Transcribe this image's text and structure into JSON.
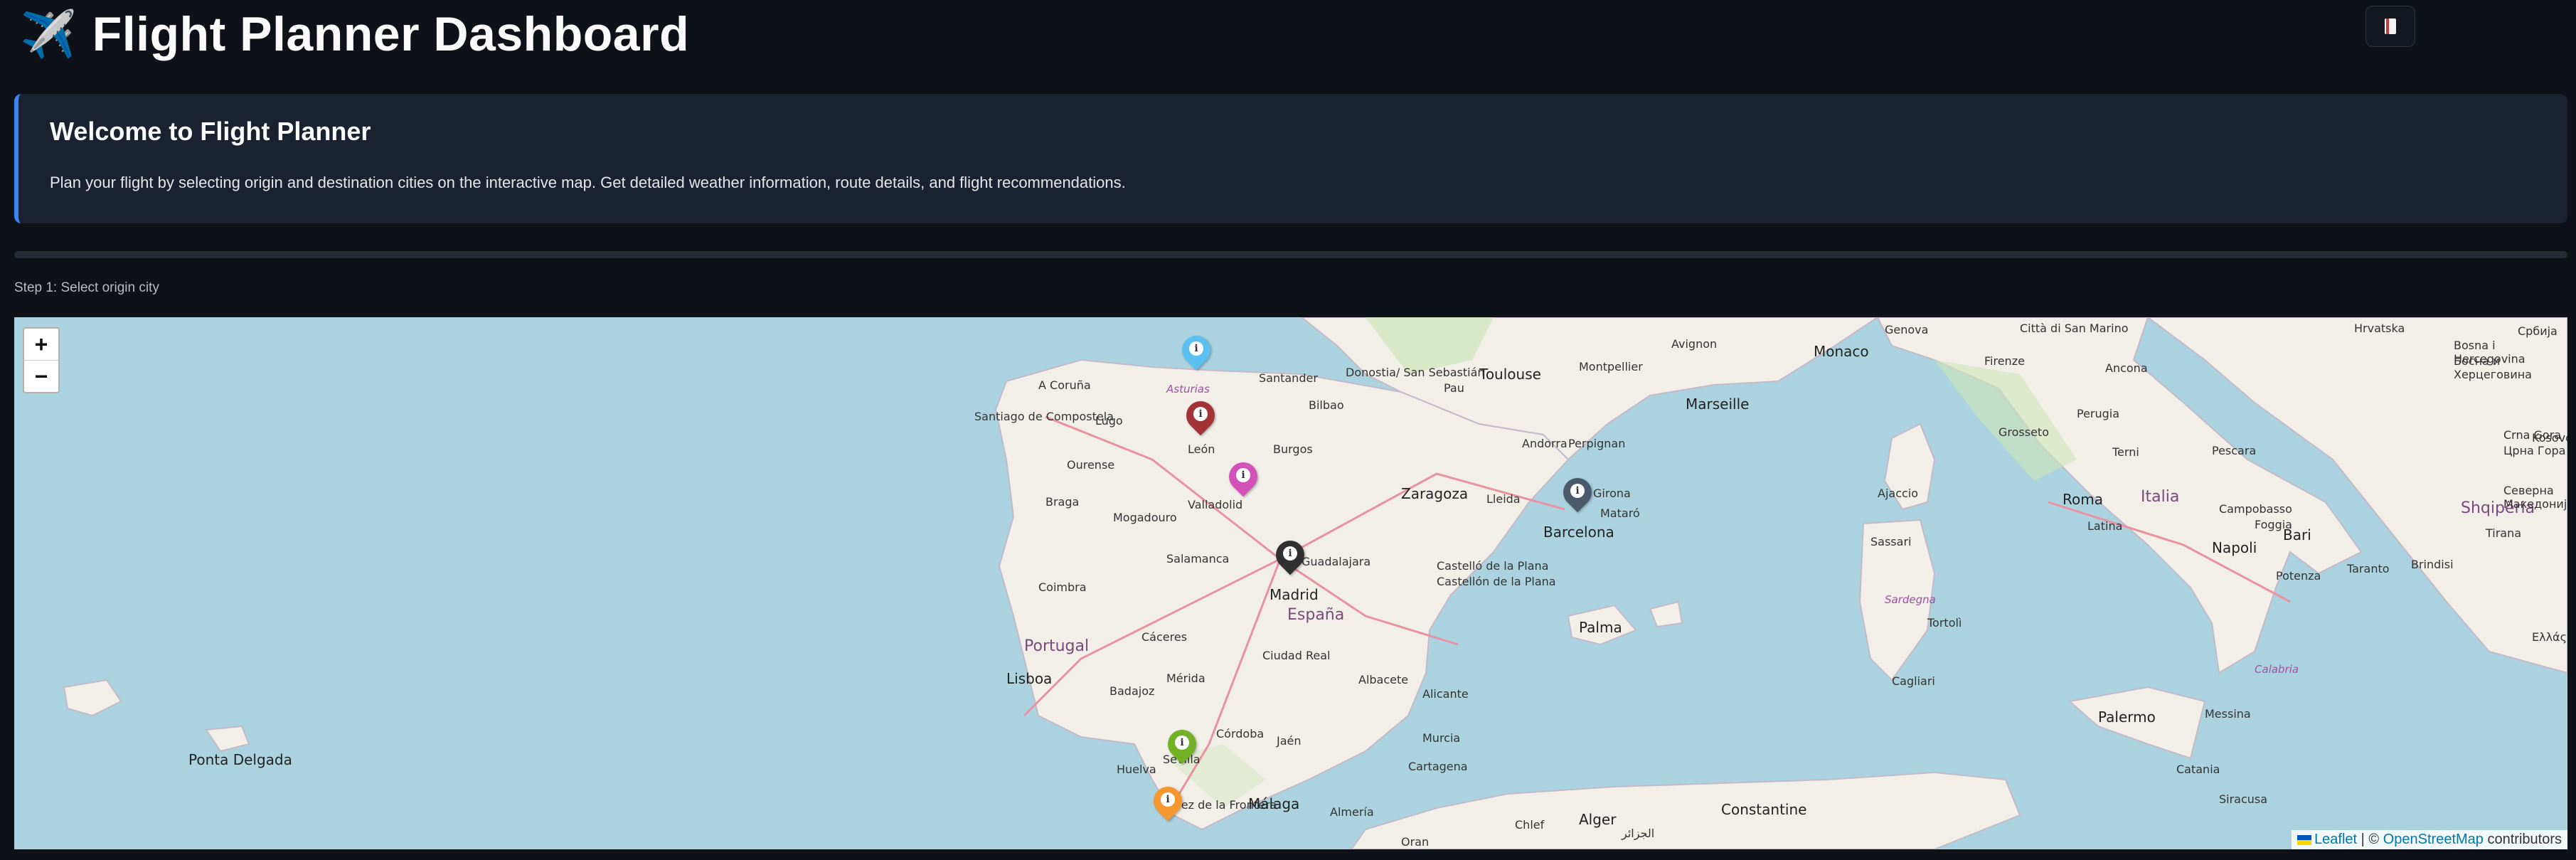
{
  "header": {
    "title": "Flight Planner Dashboard",
    "plane_icon": "✈️",
    "deploy_icon": "book-icon"
  },
  "welcome": {
    "title": "Welcome to Flight Planner",
    "text": "Plan your flight by selecting origin and destination cities on the interactive map. Get detailed weather information, route details, and flight recommendations."
  },
  "step_label": "Step 1: Select origin city",
  "map": {
    "zoom_in": "+",
    "zoom_out": "−",
    "attribution": {
      "leaflet": "Leaflet",
      "separator": " | © ",
      "osm": "OpenStreetMap",
      "suffix": " contributors"
    },
    "markers": [
      {
        "color": "#5bc0f0"
      },
      {
        "color": "#a23336"
      },
      {
        "color": "#d252b9"
      },
      {
        "color": "#4a5a6a"
      },
      {
        "color": "#303030"
      },
      {
        "color": "#72b026"
      },
      {
        "color": "#f69730"
      }
    ],
    "labels": [
      "Genova",
      "Monaco",
      "Città di San Marino",
      "Hrvatska",
      "Bosna i Hercegovina",
      "Босна и Херцеговина",
      "Србија",
      "Montpellier",
      "Avignon",
      "Toulouse",
      "Firenze",
      "Ancona",
      "Grosseto",
      "Perugia",
      "Crna Gora",
      "Црна Гора",
      "Marseille",
      "Pau",
      "Andorra",
      "Perpignan",
      "Santander",
      "Donostia/ San Sebastián",
      "Bilbao",
      "Asturias",
      "A Coruña",
      "Santiago de Compostela",
      "Lugo",
      "León",
      "Burgos",
      "Ourense",
      "Valladolid",
      "Zaragoza",
      "Lleida",
      "Girona",
      "Mataró",
      "Barcelona",
      "Braga",
      "Mogadouro",
      "Salamanca",
      "Guadalajara",
      "Madrid",
      "España",
      "Castelló de la Plana",
      "Castellón de la Plana",
      "Coimbra",
      "Portugal",
      "Cáceres",
      "Lisboa",
      "Mérida",
      "Ciudad Real",
      "Albacete",
      "Alicante",
      "Badajoz",
      "Córdoba",
      "Jaén",
      "Murcia",
      "Cartagena",
      "Huelva",
      "Sevilla",
      "Jerez de la Frontera",
      "Málaga",
      "Almería",
      "Palma",
      "Roma",
      "Italia",
      "Napoli",
      "Potenza",
      "Foggia",
      "Bari",
      "Taranto",
      "Brindisi",
      "Tirana",
      "Shqipëria",
      "Sardegna",
      "Cagliari",
      "Sassari",
      "Tortolì",
      "Ajaccio",
      "Palermo",
      "Messina",
      "Catania",
      "Siracusa",
      "Calabria",
      "Ελλάς",
      "Alger",
      "الجزائر",
      "Constantine",
      "Chlef",
      "Oran",
      "Kosovo",
      "Северна Македонија",
      "Ponta Delgada",
      "Terni",
      "Latina",
      "Campobasso",
      "Pescara",
      "Napoli"
    ]
  }
}
